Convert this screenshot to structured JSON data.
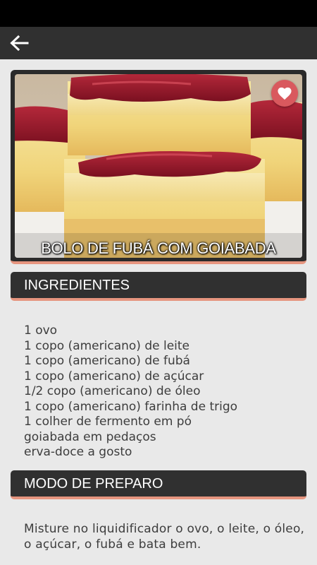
{
  "header": {
    "back_icon": "arrow-left-icon"
  },
  "recipe": {
    "title": "BOLO DE FUBÁ COM GOIABADA",
    "favorite_icon": "heart-icon"
  },
  "sections": {
    "ingredients_title": "INGREDIENTES",
    "ingredients": [
      "1 ovo",
      "1 copo (americano) de leite",
      "1 copo (americano) de fubá",
      "1 copo (americano) de açúcar",
      "1/2 copo (americano) de óleo",
      "1 copo (americano) farinha de trigo",
      "1 colher de fermento em pó",
      "goiabada em pedaços",
      "erva-doce a gosto"
    ],
    "prep_title": "MODO DE PREPARO",
    "prep_text": "Misture no liquidificador o ovo, o leite, o óleo, o açúcar, o fubá e bata bem."
  },
  "colors": {
    "toolbar": "#303030",
    "accent": "#e6957f",
    "favorite": "#d9595e",
    "background": "#e9e9e9"
  }
}
